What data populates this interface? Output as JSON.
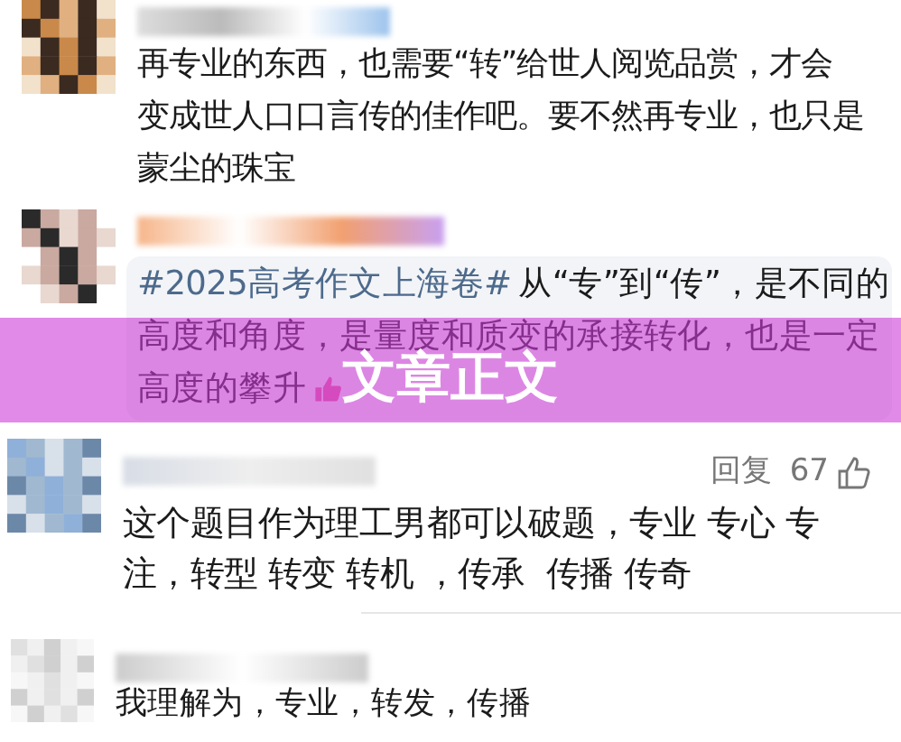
{
  "comments": [
    {
      "lines": [
        "再专业的东西，也需要“转”给世人阅览品赏，才会",
        "变成世人口口言传的佳作吧。要不然再专业，也只是",
        "蒙尘的珠宝"
      ]
    },
    {
      "hashtag": "#2025高考作文上海卷#",
      "lines": [
        "从“专”到“传”，是不同的",
        "高度和角度，是量度和质变的承接转化，也是一定",
        "高度的攀升"
      ]
    },
    {
      "reply": "回复",
      "likes": "67",
      "lines": [
        "这个题目作为理工男都可以破题，专业 专心 专",
        "注，转型 转变 转机 ，传承  传播 传奇"
      ]
    },
    {
      "lines": [
        "我理解为，专业，转发，传播"
      ]
    }
  ],
  "banner": {
    "title": "文章正文"
  }
}
